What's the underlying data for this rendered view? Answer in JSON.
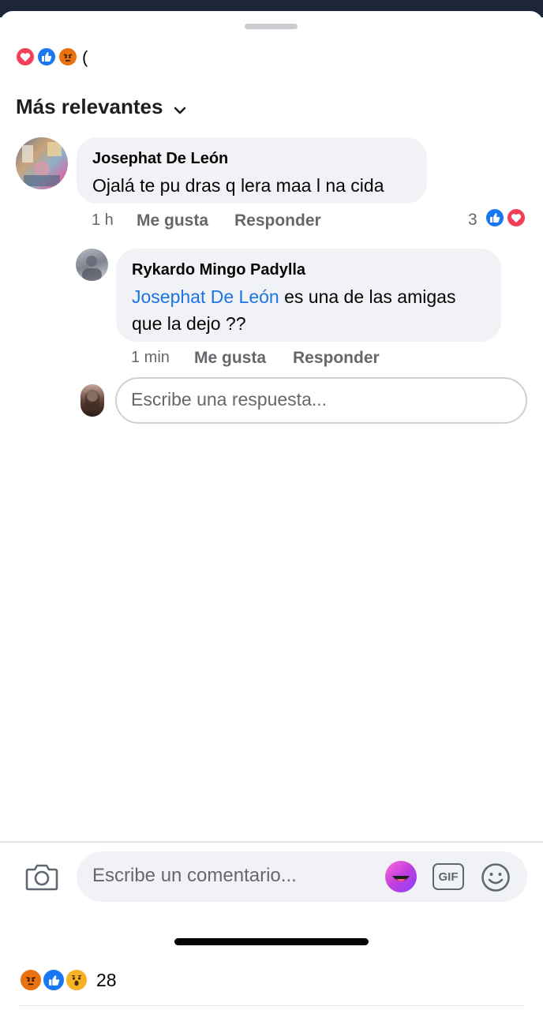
{
  "reactions_header": {
    "icons": [
      "love-icon",
      "like-icon",
      "angry-icon"
    ],
    "trailing_text": "("
  },
  "sort": {
    "label": "Más relevantes",
    "icon": "chevron-down-icon"
  },
  "comments": [
    {
      "author": "Josephat De León",
      "text": "Ojalá te pu dras q lera maa l na cida",
      "time": "1 h",
      "like_label": "Me gusta",
      "reply_label": "Responder",
      "reaction_count": "3",
      "reaction_icons": [
        "like-icon",
        "love-icon"
      ]
    }
  ],
  "replies": [
    {
      "author": "Rykardo Mingo Padylla",
      "mention": "Josephat De León",
      "text_line1": " es una de las amigas",
      "text_line2": "que la dejo ??",
      "time": "1 min",
      "like_label": "Me gusta",
      "reply_label": "Responder"
    }
  ],
  "reply_input": {
    "placeholder": "Escribe una respuesta..."
  },
  "comment_bar": {
    "placeholder": "Escribe un comentario...",
    "camera_icon": "camera-icon",
    "avatar_sticker_icon": "avatar-sticker-icon",
    "gif_label": "GIF",
    "emoji_icon": "smiley-icon"
  },
  "post_reactions": {
    "icons": [
      "angry-icon",
      "like-icon",
      "wow-icon"
    ],
    "count": "28"
  },
  "colors": {
    "like_blue": "#1877f2",
    "love_red": "#f33e58",
    "angry_orange": "#e9710f",
    "mention_blue": "#1b74e4",
    "bubble_gray": "#f0f2f5",
    "meta_gray": "#65676b"
  }
}
